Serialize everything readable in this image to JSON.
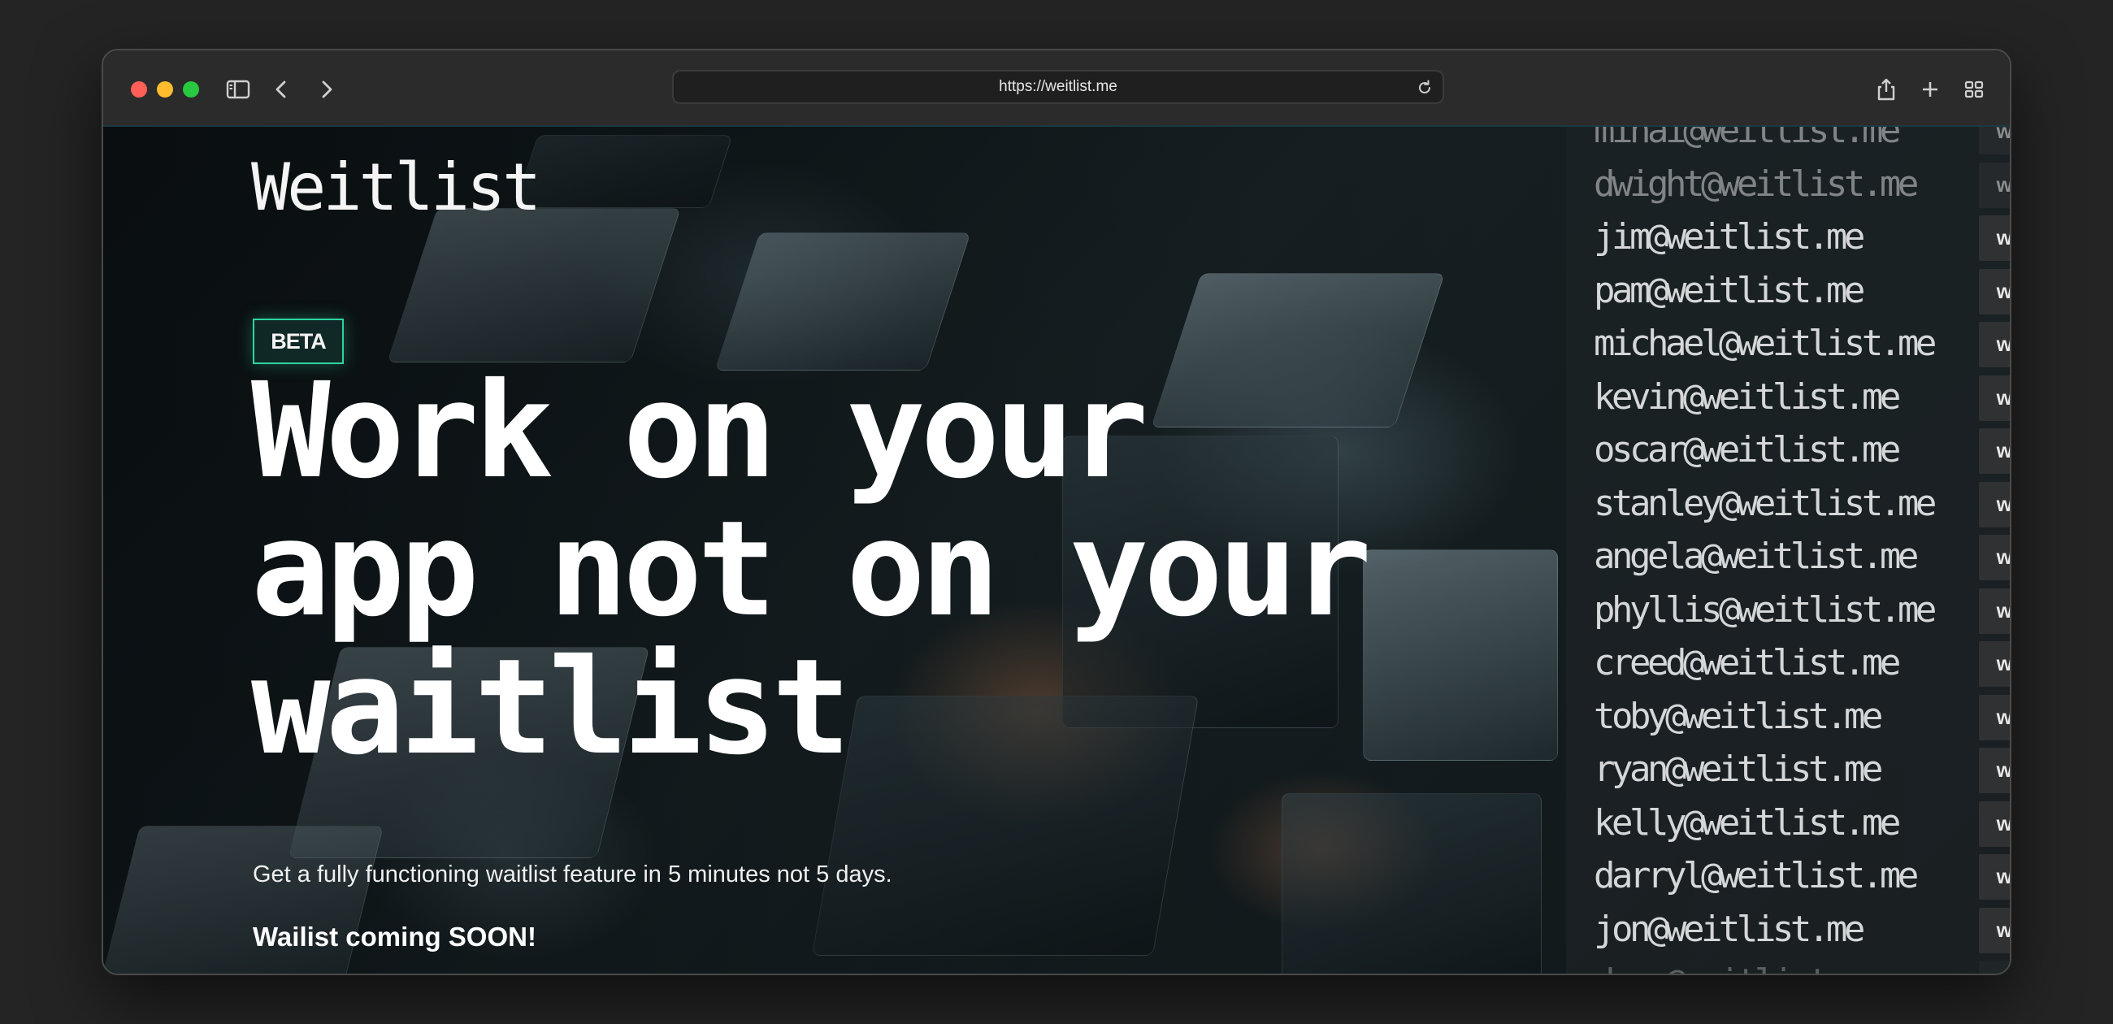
{
  "browser": {
    "url": "https://weitlist.me"
  },
  "page": {
    "logo": "Weitlist",
    "badge": "BETA",
    "headline_lines": [
      "Work on your",
      "app not on your",
      "waitlist"
    ],
    "subtitle": "Get a fully functioning waitlist feature in 5 minutes not 5 days.",
    "coming_soon": "Wailist coming SOON!"
  },
  "emails": {
    "button_label": "weitlist",
    "items": [
      "mihai@weitlist.me",
      "dwight@weitlist.me",
      "jim@weitlist.me",
      "pam@weitlist.me",
      "michael@weitlist.me",
      "kevin@weitlist.me",
      "oscar@weitlist.me",
      "stanley@weitlist.me",
      "angela@weitlist.me",
      "phyllis@weitlist.me",
      "creed@weitlist.me",
      "toby@weitlist.me",
      "ryan@weitlist.me",
      "kelly@weitlist.me",
      "darryl@weitlist.me",
      "jon@weitlist.me",
      "dave@weitlist.me"
    ]
  },
  "colors": {
    "accent": "#2fd3a0",
    "traffic_red": "#ff5f57",
    "traffic_yellow": "#febc2e",
    "traffic_green": "#28c840"
  }
}
